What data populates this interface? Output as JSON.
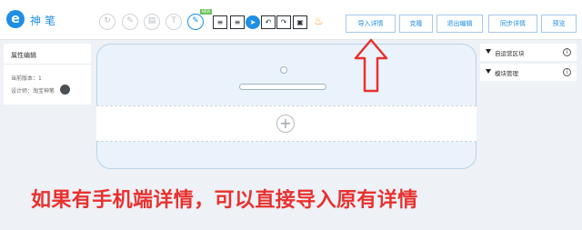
{
  "app": {
    "logo": "e",
    "brand": "神笔"
  },
  "toolbar": {
    "circle_icons": [
      "undo-circle-icon",
      "edit-circle-icon",
      "layout-circle-icon",
      "text-circle-icon",
      "pen-circle-icon"
    ],
    "new_badge": "NEW",
    "square_icons": [
      "align-icon",
      "align-bottom-icon",
      "compass-icon",
      "undo-icon",
      "redo-icon",
      "save-icon"
    ],
    "bell_icon": "bell-icon",
    "buttons": {
      "import": "导入详情",
      "clone": "克隆",
      "exit": "退出编辑",
      "sync": "同步详情",
      "preview": "预览"
    }
  },
  "left_panel": {
    "title": "属性编辑",
    "version": "当前版本：1",
    "designer": "设计师：淘宝神笔"
  },
  "right_panel": {
    "items": [
      "自运营区块",
      "模块管理"
    ]
  },
  "canvas": {
    "add_symbol": "+"
  },
  "caption": "如果有手机端详情，可以直接导入原有详情",
  "colors": {
    "accent": "#1f8fe5",
    "caption": "#e8312f",
    "arrow": "#e8312f",
    "bell": "#f5a623"
  }
}
